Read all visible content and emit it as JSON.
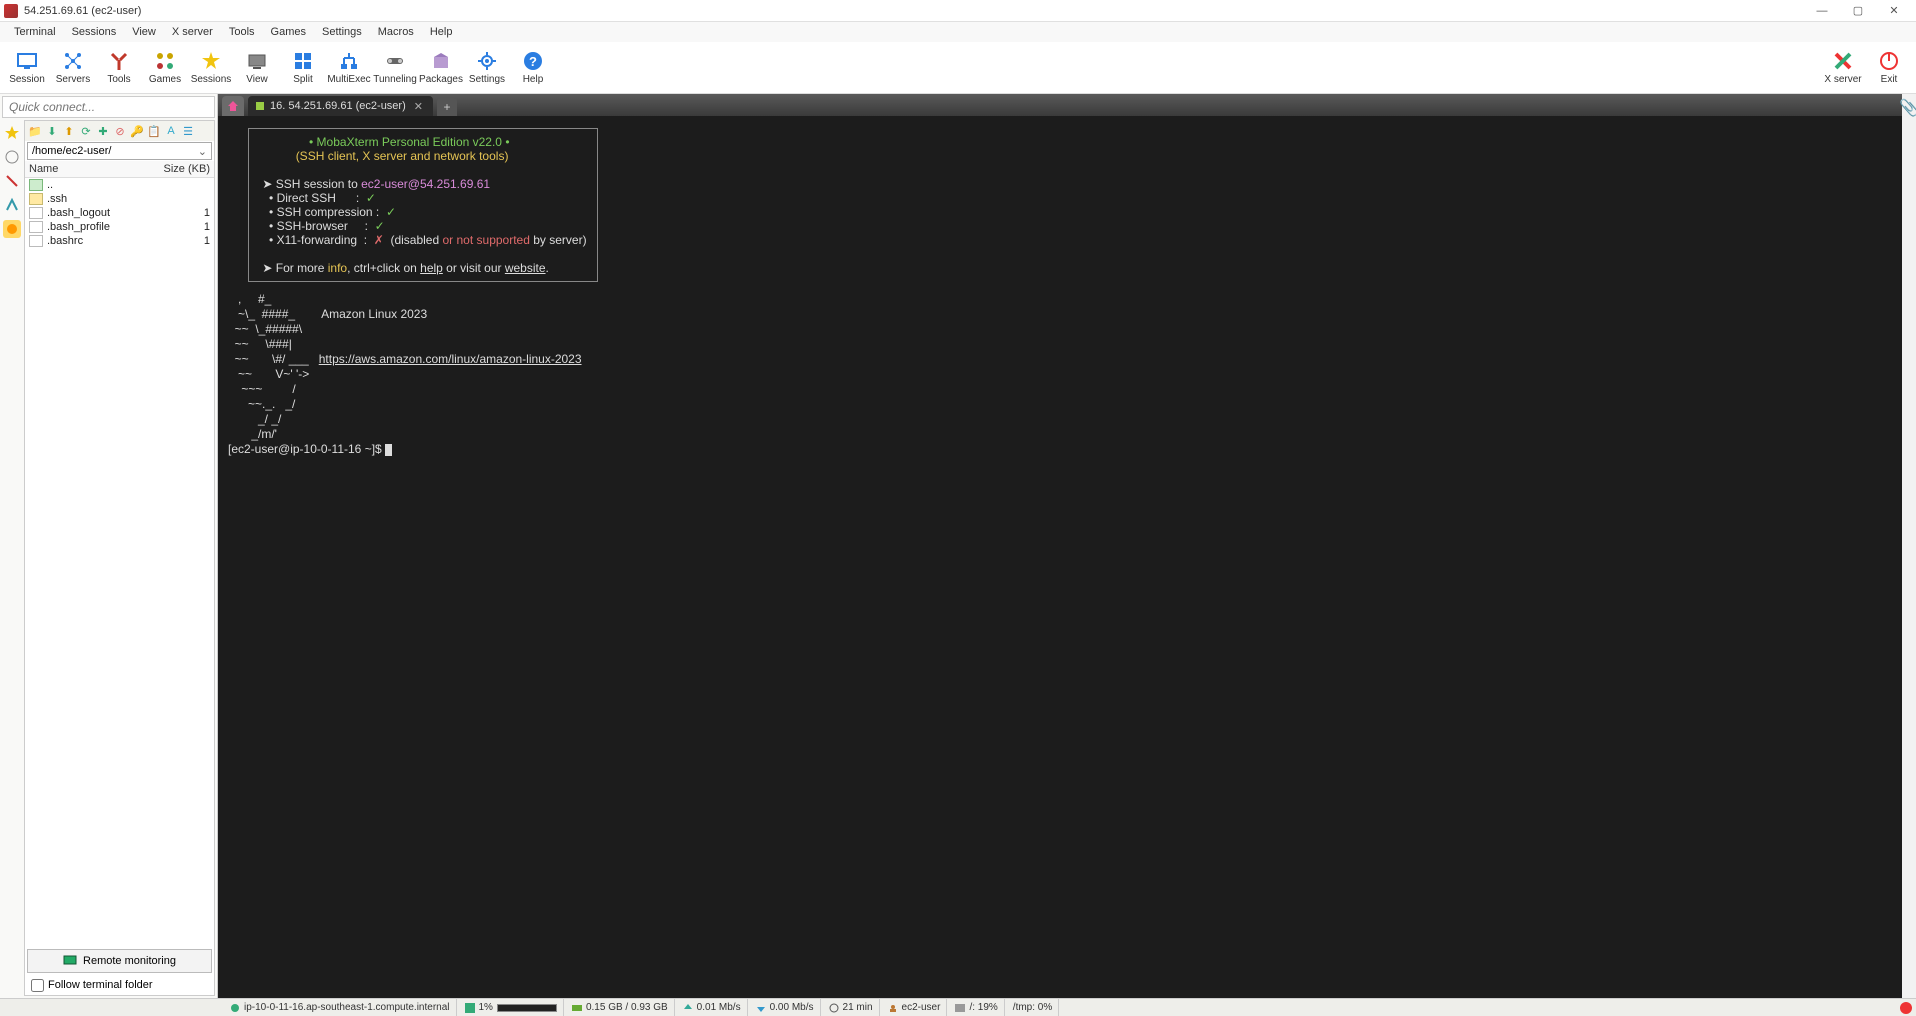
{
  "window": {
    "title": "54.251.69.61 (ec2-user)"
  },
  "menu": [
    "Terminal",
    "Sessions",
    "View",
    "X server",
    "Tools",
    "Games",
    "Settings",
    "Macros",
    "Help"
  ],
  "toolbar": [
    {
      "label": "Session",
      "icon": "session-icon",
      "color": "#2a7de1"
    },
    {
      "label": "Servers",
      "icon": "servers-icon",
      "color": "#2a7de1"
    },
    {
      "label": "Tools",
      "icon": "tools-icon",
      "color": "#c0392b"
    },
    {
      "label": "Games",
      "icon": "games-icon",
      "color": "#7a7a00"
    },
    {
      "label": "Sessions",
      "icon": "sessions-star-icon",
      "color": "#f1c40f"
    },
    {
      "label": "View",
      "icon": "view-icon",
      "color": "#555"
    },
    {
      "label": "Split",
      "icon": "split-icon",
      "color": "#2a7de1"
    },
    {
      "label": "MultiExec",
      "icon": "multiexec-icon",
      "color": "#2a7de1"
    },
    {
      "label": "Tunneling",
      "icon": "tunneling-icon",
      "color": "#555"
    },
    {
      "label": "Packages",
      "icon": "packages-icon",
      "color": "#7a5c99"
    },
    {
      "label": "Settings",
      "icon": "settings-icon",
      "color": "#2a7de1"
    },
    {
      "label": "Help",
      "icon": "help-icon",
      "color": "#2a7de1"
    }
  ],
  "toolbar_right": [
    {
      "label": "X server",
      "icon": "xserver-icon"
    },
    {
      "label": "Exit",
      "icon": "exit-icon"
    }
  ],
  "sidebar": {
    "quick_connect_placeholder": "Quick connect...",
    "path": "/home/ec2-user/",
    "headers": {
      "name": "Name",
      "size": "Size (KB)"
    },
    "files": [
      {
        "name": "..",
        "size": "",
        "type": "up"
      },
      {
        "name": ".ssh",
        "size": "",
        "type": "dir"
      },
      {
        "name": ".bash_logout",
        "size": "1",
        "type": "file"
      },
      {
        "name": ".bash_profile",
        "size": "1",
        "type": "file"
      },
      {
        "name": ".bashrc",
        "size": "1",
        "type": "file"
      }
    ],
    "remote_monitoring": "Remote monitoring",
    "follow_label": "Follow terminal folder"
  },
  "tabs": {
    "active": "16. 54.251.69.61 (ec2-user)"
  },
  "term": {
    "banner1": "• MobaXterm Personal Edition v22.0 •",
    "banner2": "(SSH client, X server and network tools)",
    "sess_prefix": "SSH session to ",
    "sess_target": "ec2-user@54.251.69.61",
    "l1": "Direct SSH      :  ",
    "l2": "SSH compression :  ",
    "l3": "SSH-browser     :  ",
    "l4a": "X11-forwarding  :  ",
    "l4b": "  (disabled ",
    "l4c": "or ",
    "l4d": "not supported",
    "l4e": " by server)",
    "more1": "For more ",
    "more_info": "info",
    "more2": ", ctrl+click on ",
    "more_help": "help",
    "more3": " or visit our ",
    "more_site": "website",
    "more4": ".",
    "ascii": "   ,     #_\n   ~\\_  ####_        Amazon Linux 2023\n  ~~  \\_#####\\\n  ~~     \\###|\n  ~~       \\#/ ___   https://aws.amazon.com/linux/amazon-linux-2023\n   ~~       V~' '->\n    ~~~         /\n      ~~._.   _/\n         _/ _/\n       _/m/'",
    "amazon_label": "Amazon Linux 2023",
    "amazon_url": "https://aws.amazon.com/linux/amazon-linux-2023",
    "prompt": "[ec2-user@ip-10-0-11-16 ~]$ "
  },
  "status": {
    "host": "ip-10-0-11-16.ap-southeast-1.compute.internal",
    "cpu": "1%",
    "mem": "0.15 GB / 0.93 GB",
    "up": "0.01 Mb/s",
    "down": "0.00 Mb/s",
    "uptime": "21 min",
    "user": "ec2-user",
    "disk": "/: 19%",
    "tmp": "/tmp: 0%"
  }
}
